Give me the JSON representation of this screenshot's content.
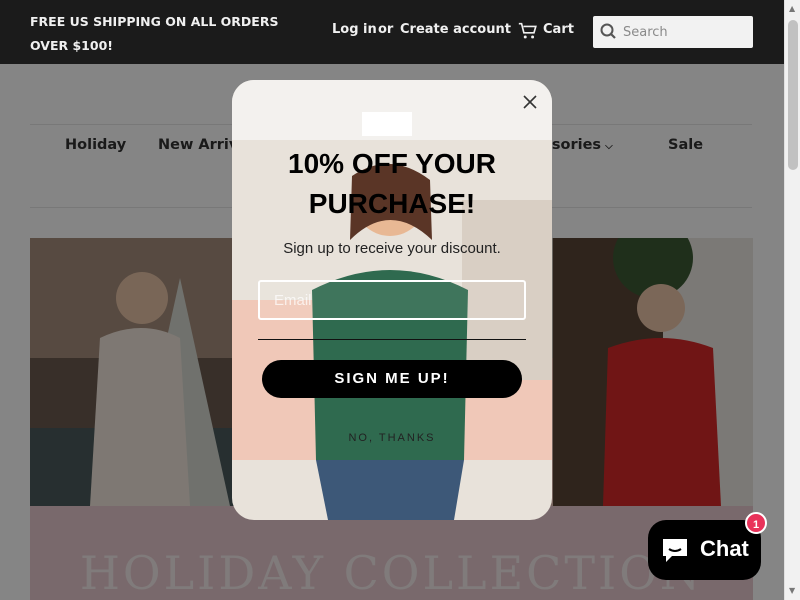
{
  "header": {
    "promo_text": "FREE US SHIPPING ON ALL ORDERS OVER $100!",
    "login_label": "Log in",
    "or_label": "or",
    "create_account_label": "Create account",
    "cart_label": "Cart",
    "cart_icon": "cart-icon",
    "search_placeholder": "Search",
    "search_icon": "search-icon"
  },
  "nav": {
    "items": [
      {
        "label": "Holiday",
        "has_dropdown": false
      },
      {
        "label": "New Arrivals",
        "has_dropdown": false
      },
      {
        "label": "Accessories",
        "has_dropdown": true
      },
      {
        "label": "Sale",
        "has_dropdown": false
      }
    ]
  },
  "hero": {
    "title": "HOLIDAY COLLECTION"
  },
  "popup": {
    "heading": "10% OFF YOUR PURCHASE!",
    "subheading": "Sign up to receive your discount.",
    "email_placeholder": "Email",
    "cta_label": "SIGN ME UP!",
    "decline_label": "NO, THANKS",
    "close_icon": "close-icon"
  },
  "chat": {
    "label": "Chat",
    "badge_count": "1",
    "icon": "chat-bubble-icon"
  },
  "colors": {
    "topbar_bg": "#1b1b1b",
    "cta_bg": "#000000",
    "badge": "#e9325a"
  }
}
